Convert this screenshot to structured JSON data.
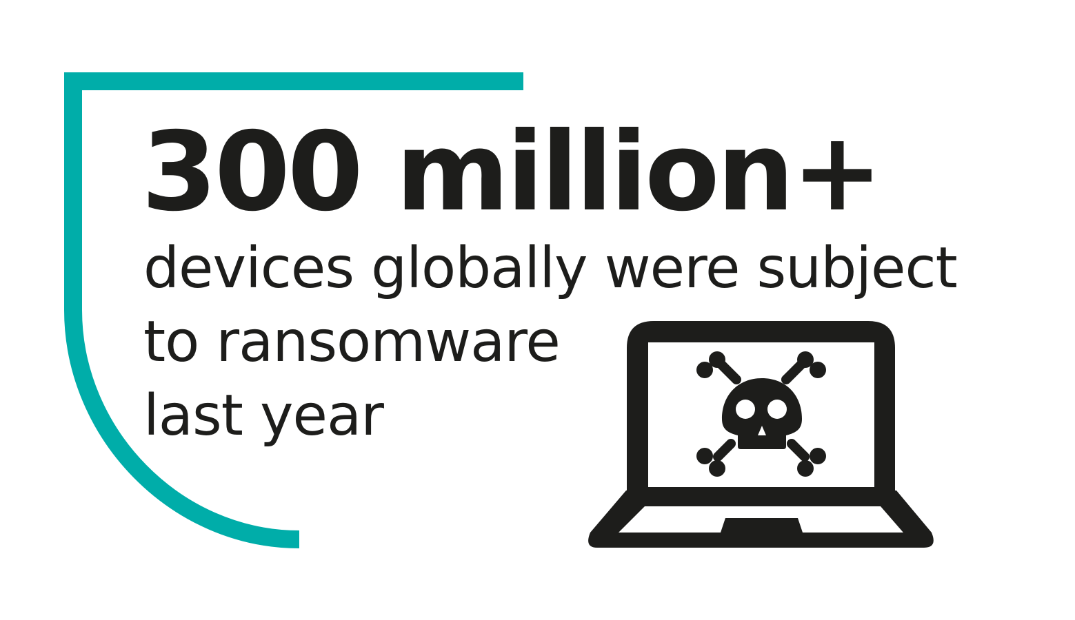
{
  "headline": "300 million+",
  "subtext_lines": [
    "devices globally were subject",
    "to ransomware",
    "last year"
  ],
  "icons": {
    "laptop": "laptop-skull-crossbones-icon"
  },
  "colors": {
    "accent": "#00ADA9",
    "text": "#1D1D1B",
    "background": "#FFFFFF"
  }
}
